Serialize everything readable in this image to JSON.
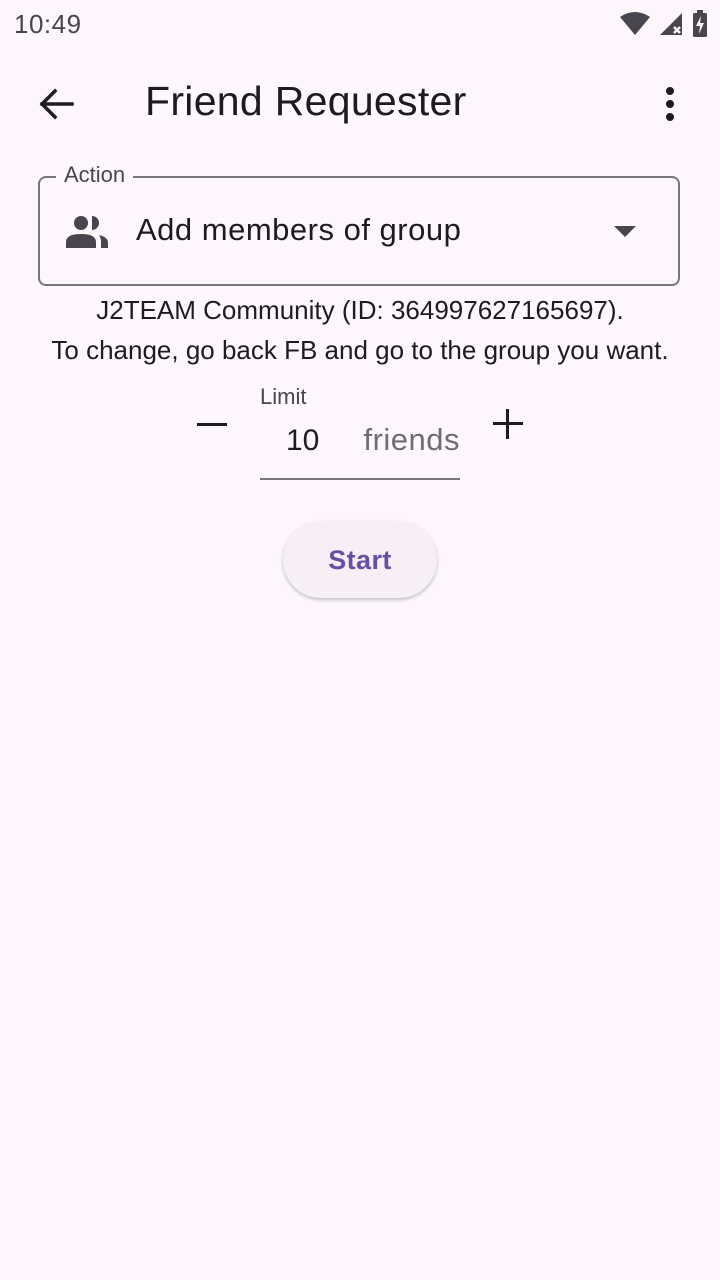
{
  "status_bar": {
    "time": "10:49",
    "icons": [
      "wifi-icon",
      "signal-icon",
      "battery-charging-icon"
    ]
  },
  "app_bar": {
    "title": "Friend Requester",
    "back_icon": "arrow-back-icon",
    "menu_icon": "more-vert-icon"
  },
  "action": {
    "label": "Action",
    "icon": "group-icon",
    "value": "Add members of group"
  },
  "group_info": {
    "line1": "J2TEAM Community (ID: 364997627165697).",
    "line2": "To change, go back FB and go to the group you want."
  },
  "limit": {
    "label": "Limit",
    "value": "10",
    "suffix": "friends"
  },
  "start_button": {
    "label": "Start"
  },
  "colors": {
    "background": "#fdf7fb",
    "primary": "#6750a4",
    "text": "#1c1b1f",
    "outline": "#79757f"
  }
}
